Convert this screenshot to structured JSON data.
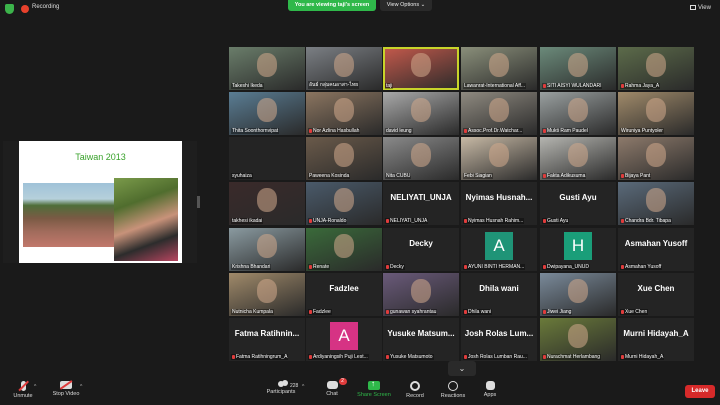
{
  "topbar": {
    "recording_label": "Recording",
    "viewing_banner": "You are viewing taji's screen",
    "view_options": "View Options ⌄",
    "view_button": "View"
  },
  "shared_screen": {
    "slide_title": "Taiwan 2013"
  },
  "participants": [
    {
      "name": "Takeshi Ikeda",
      "video": true,
      "muted": false
    },
    {
      "name": "อันธ์ กลุ่มคนอาสา-ไทย",
      "video": true,
      "muted": false
    },
    {
      "name": "taji",
      "video": true,
      "muted": false,
      "active": true
    },
    {
      "name": "Lawanrat-International Aff...",
      "video": true,
      "muted": false
    },
    {
      "name": "SITI AISYI WULANDARI",
      "video": true,
      "muted": true
    },
    {
      "name": "Rahma Jaya_A",
      "video": true,
      "muted": true
    },
    {
      "name": "Thita  Soonthornvipat",
      "video": true,
      "muted": false
    },
    {
      "name": "Nor Azlina Hasbullah",
      "video": true,
      "muted": true
    },
    {
      "name": "david leung",
      "video": true,
      "muted": false
    },
    {
      "name": "Assoc.Prof.Dr.Watchar...",
      "video": true,
      "muted": true
    },
    {
      "name": "Mukti Ram Paudel",
      "video": true,
      "muted": true
    },
    {
      "name": "Wiruniya Puntyoler",
      "video": true,
      "muted": false
    },
    {
      "name": "syuhaiza",
      "video": false,
      "muted": false
    },
    {
      "name": "Paweena Kosinda",
      "video": true,
      "muted": false
    },
    {
      "name": "Nita CUBU",
      "video": true,
      "muted": false
    },
    {
      "name": "Febi Siagian",
      "video": true,
      "muted": false
    },
    {
      "name": "Fakta Adikusuma",
      "video": true,
      "muted": true
    },
    {
      "name": "Bijaya Pant",
      "video": true,
      "muted": true
    },
    {
      "name": "takhesi ikadai",
      "video": true,
      "muted": false
    },
    {
      "name": "UNJA-Ronaldo",
      "video": true,
      "muted": true
    },
    {
      "name": "NELIYATI_UNJA",
      "big": "NELIYATI_UNJA",
      "video": false,
      "muted": true
    },
    {
      "name": "Nyimas Husnah Rahim...",
      "big": "Nyimas  Husnah...",
      "video": false,
      "muted": true
    },
    {
      "name": "Gusti Ayu",
      "big": "Gusti Ayu",
      "video": false,
      "muted": true
    },
    {
      "name": "Chandra Bdr. Tibapa",
      "video": true,
      "muted": true
    },
    {
      "name": "Krishna Bhandari",
      "video": true,
      "muted": false
    },
    {
      "name": "Renate",
      "video": true,
      "muted": true
    },
    {
      "name": "Decky",
      "big": "Decky",
      "video": false,
      "muted": true
    },
    {
      "name": "AYUNI BINTI HERMAN...",
      "avatar": "A",
      "avatar_color": "#1f9477",
      "video": false,
      "muted": true
    },
    {
      "name": "Dwipayana_UNUD",
      "avatar": "H",
      "avatar_color": "#1a9e79",
      "video": false,
      "muted": true
    },
    {
      "name": "Asmahan Yusoff",
      "big": "Asmahan Yusoff",
      "video": false,
      "muted": true
    },
    {
      "name": "Nutnicha Kumpala",
      "video": true,
      "muted": false
    },
    {
      "name": "Fadzlee",
      "big": "Fadzlee",
      "video": false,
      "muted": true
    },
    {
      "name": "gunawan syahrantau",
      "video": true,
      "muted": true
    },
    {
      "name": "Dhila wani",
      "big": "Dhila wani",
      "video": false,
      "muted": true
    },
    {
      "name": "Jiwei Jiang",
      "video": true,
      "muted": true
    },
    {
      "name": "Xue Chen",
      "big": "Xue Chen",
      "video": false,
      "muted": true
    },
    {
      "name": "Fatma Ratihningrum_A",
      "big": "Fatma  Ratihnin...",
      "video": false,
      "muted": true
    },
    {
      "name": "Ardiyaningsih Puji Lest...",
      "avatar": "A",
      "avatar_color": "#d63384",
      "video": false,
      "muted": true
    },
    {
      "name": "Yusuke Matsumoto",
      "big": "Yusuke  Matsum...",
      "video": false,
      "muted": true
    },
    {
      "name": "Josh Rolas Lumban Rau...",
      "big": "Josh Rolas  Lum...",
      "video": false,
      "muted": true
    },
    {
      "name": "Nurachmat Herlambang",
      "video": true,
      "muted": true
    },
    {
      "name": "Murni Hidayah_A",
      "big": "Murni Hidayah_A",
      "video": false,
      "muted": true
    }
  ],
  "tile_colors": [
    "#6a7d6a",
    "#7b7f84",
    "#c65a4c",
    "#8a8f7a",
    "#6b8a7a",
    "#5c6b4a",
    "#5a7d94",
    "#8b7560",
    "#a9a9a9",
    "#8f8a80",
    "#9aa0a0",
    "#a08a6a",
    "#242424",
    "#6a5a4a",
    "#8a8a8a",
    "#c7b9a5",
    "#b5b5b0",
    "#8d7a6b",
    "#3a2a2a",
    "#4a5a6a",
    "#242424",
    "#242424",
    "#242424",
    "#5a6a7a",
    "#8a9aa0",
    "#3a6a3a",
    "#242424",
    "#242424",
    "#242424",
    "#242424",
    "#a08a6a",
    "#242424",
    "#6a5a7a",
    "#242424",
    "#7a8a9a",
    "#242424",
    "#242424",
    "#242424",
    "#242424",
    "#242424",
    "#6a7a3a",
    "#242424"
  ],
  "toolbar": {
    "unmute": "Unmute",
    "stop_video": "Stop Video",
    "participants": "Participants",
    "participants_count": "228",
    "chat": "Chat",
    "chat_badge": "2",
    "share_screen": "Share Screen",
    "record": "Record",
    "reactions": "Reactions",
    "apps": "Apps",
    "leave": "Leave"
  }
}
